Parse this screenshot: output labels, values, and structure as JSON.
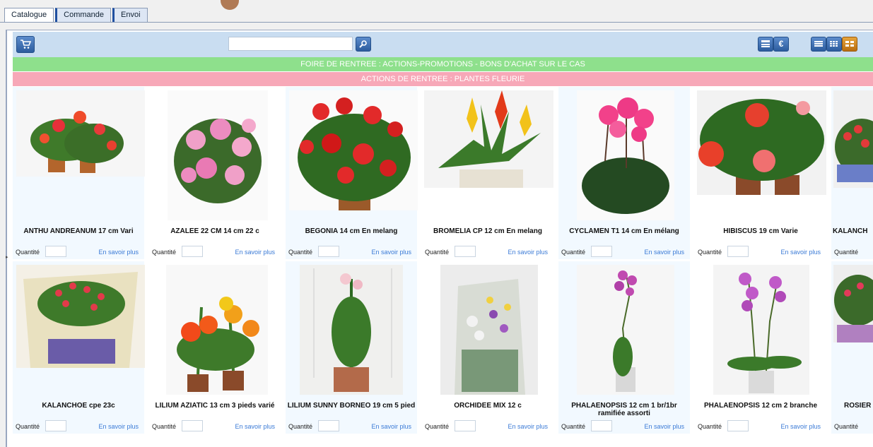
{
  "tabs": [
    "Catalogue",
    "Commande",
    "Envoi"
  ],
  "toolbar": {
    "search_value": "",
    "cart_icon": "cart-icon",
    "euro_label": "€"
  },
  "banners": [
    "FOIRE DE RENTREE : ACTIONS-PROMOTIONS - BONS D'ACHAT SUR LE CAS",
    "ACTIONS DE RENTREE : PLANTES FLEURIE"
  ],
  "labels": {
    "quantity": "Quantité",
    "more": "En savoir plus"
  },
  "colors": {
    "banner_green": "#8ee08c",
    "banner_pink": "#f7a8b8",
    "toolbar_bg": "#c9ddf1",
    "link": "#3a7ad6"
  },
  "products_row1": [
    "ANTHU ANDREANUM 17 cm Vari",
    "AZALEE 22 CM 14 cm 22 c",
    "BEGONIA 14 cm En melang",
    "BROMELIA CP 12 cm En melang",
    "CYCLAMEN T1 14 cm En mélang",
    "HIBISCUS 19 cm Varie",
    "KALANCH"
  ],
  "products_row2": [
    "KALANCHOE cpe 23c",
    "LILIUM AZIATIC 13 cm 3 pieds varié",
    "LILIUM SUNNY BORNEO 19 cm 5 pied",
    "ORCHIDEE MIX 12 c",
    "PHALAENOPSIS 12 cm 1 br/1br ramifiée assorti",
    "PHALAENOPSIS 12 cm 2 branche",
    "ROSIER"
  ]
}
